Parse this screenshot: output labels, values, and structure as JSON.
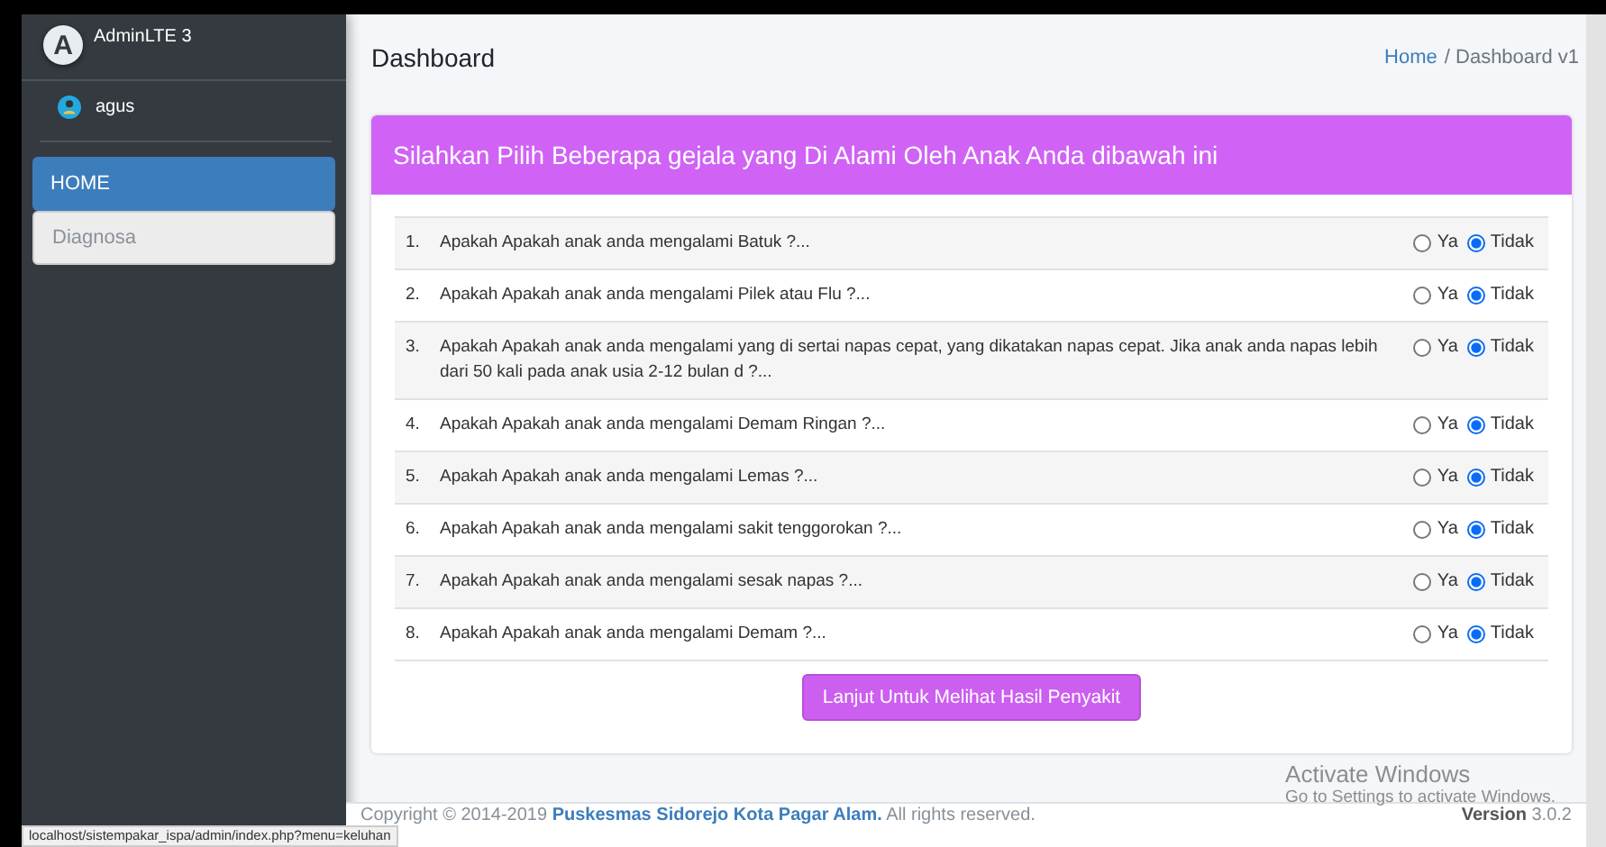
{
  "brand": {
    "name": "AdminLTE 3",
    "logo_letter": "A"
  },
  "user": {
    "name": "agus"
  },
  "sidebar": {
    "items": [
      {
        "label": "HOME",
        "selected": true
      },
      {
        "label": "Diagnosa",
        "selected": false
      }
    ]
  },
  "header": {
    "title": "Dashboard",
    "breadcrumb": [
      {
        "label": "Home",
        "kind": "link"
      },
      {
        "label": "/ Dashboard v1",
        "kind": "current"
      }
    ]
  },
  "card": {
    "title": "Silahkan Pilih Beberapa gejala yang Di Alami Oleh Anak Anda dibawah ini",
    "questions": [
      {
        "number": "1.",
        "text": "Apakah Apakah anak anda mengalami Batuk ?...",
        "options": [
          {
            "label": "Ya",
            "selected": false
          },
          {
            "label": "Tidak",
            "selected": true
          }
        ]
      },
      {
        "number": "2.",
        "text": "Apakah Apakah anak anda mengalami Pilek atau Flu ?...",
        "options": [
          {
            "label": "Ya",
            "selected": false
          },
          {
            "label": "Tidak",
            "selected": true
          }
        ]
      },
      {
        "number": "3.",
        "text": "Apakah Apakah anak anda mengalami yang di sertai napas cepat, yang dikatakan napas cepat. Jika anak anda napas lebih dari 50 kali pada anak usia 2-12 bulan d ?...",
        "options": [
          {
            "label": "Ya",
            "selected": false
          },
          {
            "label": "Tidak",
            "selected": true
          }
        ]
      },
      {
        "number": "4.",
        "text": "Apakah Apakah anak anda mengalami Demam Ringan ?...",
        "options": [
          {
            "label": "Ya",
            "selected": false
          },
          {
            "label": "Tidak",
            "selected": true
          }
        ]
      },
      {
        "number": "5.",
        "text": "Apakah Apakah anak anda mengalami Lemas ?...",
        "options": [
          {
            "label": "Ya",
            "selected": false
          },
          {
            "label": "Tidak",
            "selected": true
          }
        ]
      },
      {
        "number": "6.",
        "text": "Apakah Apakah anak anda mengalami sakit tenggorokan ?...",
        "options": [
          {
            "label": "Ya",
            "selected": false
          },
          {
            "label": "Tidak",
            "selected": true
          }
        ]
      },
      {
        "number": "7.",
        "text": "Apakah Apakah anak anda mengalami sesak napas ?...",
        "options": [
          {
            "label": "Ya",
            "selected": false
          },
          {
            "label": "Tidak",
            "selected": true
          }
        ]
      },
      {
        "number": "8.",
        "text": "Apakah Apakah anak anda mengalami Demam ?...",
        "options": [
          {
            "label": "Ya",
            "selected": false
          },
          {
            "label": "Tidak",
            "selected": true
          }
        ]
      }
    ],
    "submit_button": "Lanjut Untuk Melihat Hasil Penyakit"
  },
  "footer": {
    "copyright": "Copyright © 2014-2019 **Puskesmas Sidorejo Kota Pagar Alam.** All rights reserved.",
    "version": "**Version** 3.0.2"
  },
  "status_url": "localhost/sistempakar_ispa/admin/index.php?menu=keluhan",
  "os_notice": {
    "title": "Activate Windows",
    "subtitle": "Go to Settings to activate Windows."
  }
}
